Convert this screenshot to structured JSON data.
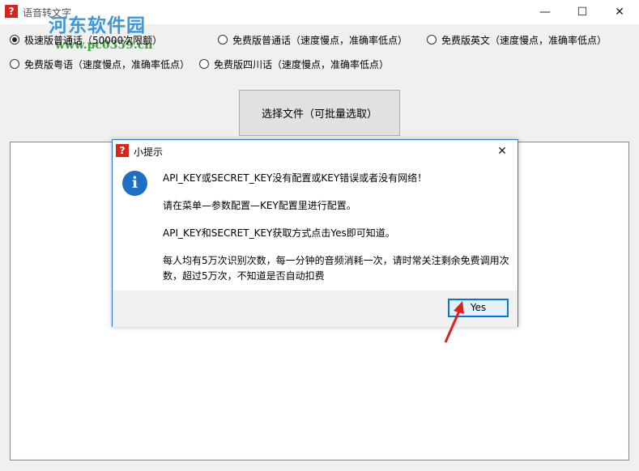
{
  "window": {
    "title": "语音转文字",
    "app_icon": "question-mark-icon",
    "controls": [
      "minimize-icon",
      "maximize-icon",
      "close-icon"
    ],
    "minimize_glyph": "—",
    "maximize_glyph": "☐",
    "close_glyph": "✕"
  },
  "watermark": {
    "text": "河东软件园",
    "url": "www.pc0359.cn"
  },
  "options": [
    {
      "label": "极速版普通话（50000次限额）",
      "checked": true
    },
    {
      "label": "免费版普通话（速度慢点，准确率低点）",
      "checked": false
    },
    {
      "label": "免费版英文（速度慢点，准确率低点）",
      "checked": false
    },
    {
      "label": "免费版粤语（速度慢点，准确率低点）",
      "checked": false
    },
    {
      "label": "免费版四川话（速度慢点，准确率低点）",
      "checked": false
    }
  ],
  "select_button": "选择文件（可批量选取）",
  "dialog": {
    "title": "小提示",
    "icon": "information-icon",
    "icon_glyph": "i",
    "close_glyph": "✕",
    "messages": [
      "API_KEY或SECRET_KEY没有配置或KEY错误或者没有网络！",
      "请在菜单—参数配置—KEY配置里进行配置。",
      "API_KEY和SECRET_KEY获取方式点击Yes即可知道。",
      "每人均有5万次识别次数，每一分钟的音频消耗一次，请时常关注剩余免费调用次数，超过5万次，不知道是否自动扣费"
    ],
    "yes_label": "Yes"
  },
  "colors": {
    "accent_border": "#2b79d1",
    "info_icon": "#1e6fc3",
    "app_icon": "#d9261c",
    "annotation_arrow": "#e02020"
  }
}
